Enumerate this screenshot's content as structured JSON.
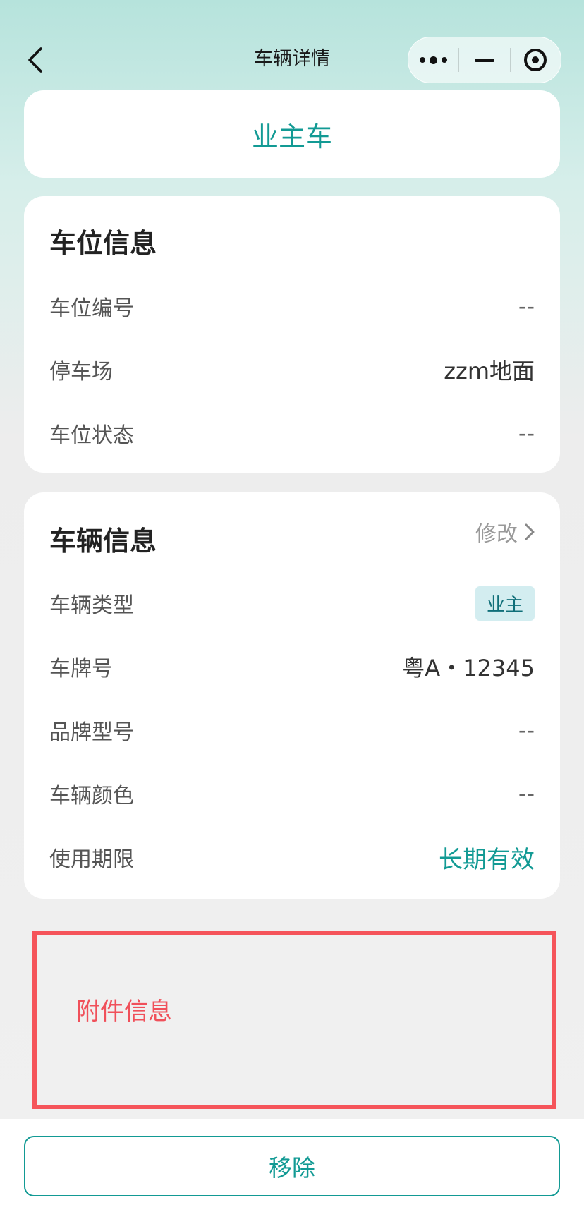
{
  "nav": {
    "title": "车辆详情"
  },
  "vehicle_category": "业主车",
  "parking_info": {
    "title": "车位信息",
    "rows": [
      {
        "label": "车位编号",
        "value": "--"
      },
      {
        "label": "停车场",
        "value": "zzm地面"
      },
      {
        "label": "车位状态",
        "value": "--"
      }
    ]
  },
  "vehicle_info": {
    "title": "车辆信息",
    "edit_label": "修改",
    "rows": [
      {
        "label": "车辆类型",
        "value": "业主"
      },
      {
        "label": "车牌号",
        "value": "粤A・12345"
      },
      {
        "label": "品牌型号",
        "value": "--"
      },
      {
        "label": "车辆颜色",
        "value": "--"
      },
      {
        "label": "使用期限",
        "value": "长期有效"
      }
    ]
  },
  "attachments": {
    "title": "附件信息"
  },
  "actions": {
    "remove_label": "移除"
  },
  "colors": {
    "accent": "#129a94",
    "highlight_border": "#f5545a",
    "badge_bg": "#d3edf0"
  }
}
